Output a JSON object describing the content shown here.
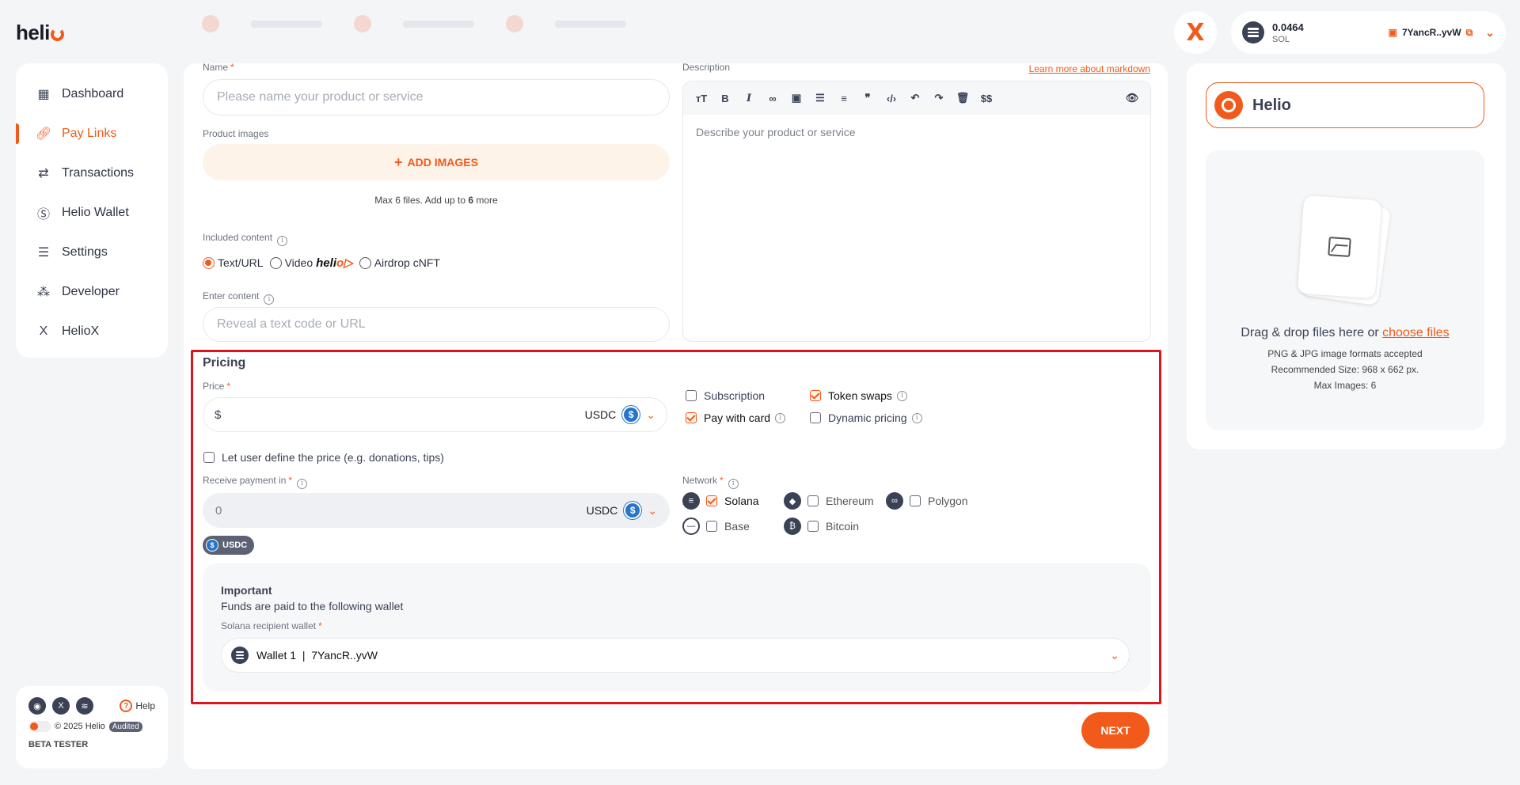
{
  "logo": "heli",
  "account": {
    "balance": "0.0464",
    "currency": "SOL",
    "wallet": "7YancR..yvW"
  },
  "sidebar": {
    "items": [
      {
        "label": "Dashboard",
        "icon": "dashboard-icon"
      },
      {
        "label": "Pay Links",
        "icon": "link-icon",
        "active": true
      },
      {
        "label": "Transactions",
        "icon": "transfer-icon"
      },
      {
        "label": "Helio Wallet",
        "icon": "dollar-circle-icon"
      },
      {
        "label": "Settings",
        "icon": "sliders-icon"
      },
      {
        "label": "Developer",
        "icon": "nodes-icon"
      },
      {
        "label": "HelioX",
        "icon": "x-logo-icon"
      }
    ],
    "help": "Help",
    "copyright": "© 2025 Helio",
    "audited": "Audited",
    "beta": "BETA TESTER"
  },
  "form": {
    "name_label": "Name",
    "name_placeholder": "Please name your product or service",
    "images_label": "Product images",
    "add_images": "ADD IMAGES",
    "max_files_prefix": "Max 6 files. Add up to ",
    "max_files_count": "6",
    "max_files_suffix": " more",
    "included_label": "Included content",
    "content_options": [
      "Text/URL",
      "Video",
      "Airdrop cNFT"
    ],
    "enter_content_label": "Enter content",
    "enter_content_placeholder": "Reveal a text code or URL",
    "description_label": "Description",
    "learn_markdown": "Learn more about markdown",
    "description_placeholder": "Describe your product or service"
  },
  "pricing": {
    "title": "Pricing",
    "price_label": "Price",
    "price_prefix": "$",
    "price_currency": "USDC",
    "options": {
      "subscription": "Subscription",
      "token_swaps": "Token swaps",
      "pay_with_card": "Pay with card",
      "dynamic_pricing": "Dynamic pricing"
    },
    "user_define": "Let user define the price (e.g. donations, tips)",
    "receive_label": "Receive payment in",
    "receive_value": "0",
    "receive_currency": "USDC",
    "chip": "USDC",
    "network_label": "Network",
    "networks": {
      "solana": "Solana",
      "ethereum": "Ethereum",
      "polygon": "Polygon",
      "base": "Base",
      "bitcoin": "Bitcoin"
    },
    "important_title": "Important",
    "important_text": "Funds are paid to the following wallet",
    "recipient_label": "Solana recipient wallet",
    "recipient_value": "Wallet 1  |  7YancR..yvW"
  },
  "next_label": "NEXT",
  "preview": {
    "brand": "Helio",
    "drag_text": "Drag & drop files here or ",
    "choose_files": "choose files",
    "formats": "PNG & JPG image formats accepted",
    "recommended": "Recommended Size: 968 x 662 px.",
    "max_images": "Max Images: 6"
  },
  "colors": {
    "accent": "#f25a1c",
    "highlight_box": "#e4121c"
  }
}
